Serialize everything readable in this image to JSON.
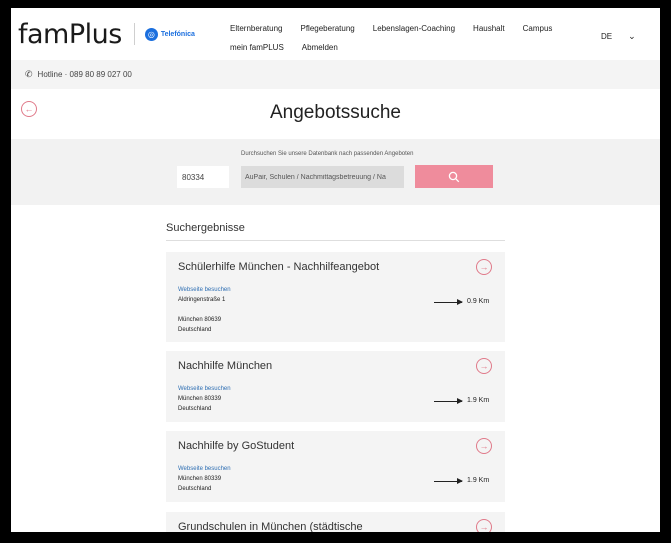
{
  "header": {
    "logo": "famPlus",
    "partner": "Telefónica",
    "nav_row1": [
      "Elternberatung",
      "Pflegeberatung",
      "Lebenslagen-Coaching",
      "Haushalt",
      "Campus"
    ],
    "nav_row2": [
      "mein famPLUS",
      "Abmelden"
    ],
    "language": "DE"
  },
  "hotline": {
    "label": "Hotline · 089 80 89 027 00"
  },
  "page": {
    "title": "Angebotssuche"
  },
  "search": {
    "hint": "Durchsuchen Sie unsere Datenbank nach passenden Angeboten",
    "zip_value": "80334",
    "category_value": "AuPair, Schulen / Nachmittagsbetreuung / Na"
  },
  "results": {
    "heading": "Suchergebnisse",
    "items": [
      {
        "title": "Schülerhilfe München - Nachhilfeangebot",
        "link": "Webseite besuchen",
        "street": "Aldringenstraße 1",
        "city": "München 80639",
        "country": "Deutschland",
        "distance": "0.9 Km"
      },
      {
        "title": "Nachhilfe München",
        "link": "Webseite besuchen",
        "city": "München 80339",
        "country": "Deutschland",
        "distance": "1.9 Km"
      },
      {
        "title": "Nachhilfe by GoStudent",
        "link": "Webseite besuchen",
        "city": "München 80339",
        "country": "Deutschland",
        "distance": "1.9 Km"
      },
      {
        "title": "Grundschulen in München (städtische"
      }
    ]
  },
  "icons": {
    "phone": "phone-icon",
    "back": "arrow-left-circle-icon",
    "search": "search-icon",
    "open": "arrow-right-circle-icon",
    "chevron": "chevron-down-icon"
  },
  "colors": {
    "accent": "#ef8c9c",
    "link": "#2f6fb3",
    "telefonica": "#1b6fde"
  }
}
